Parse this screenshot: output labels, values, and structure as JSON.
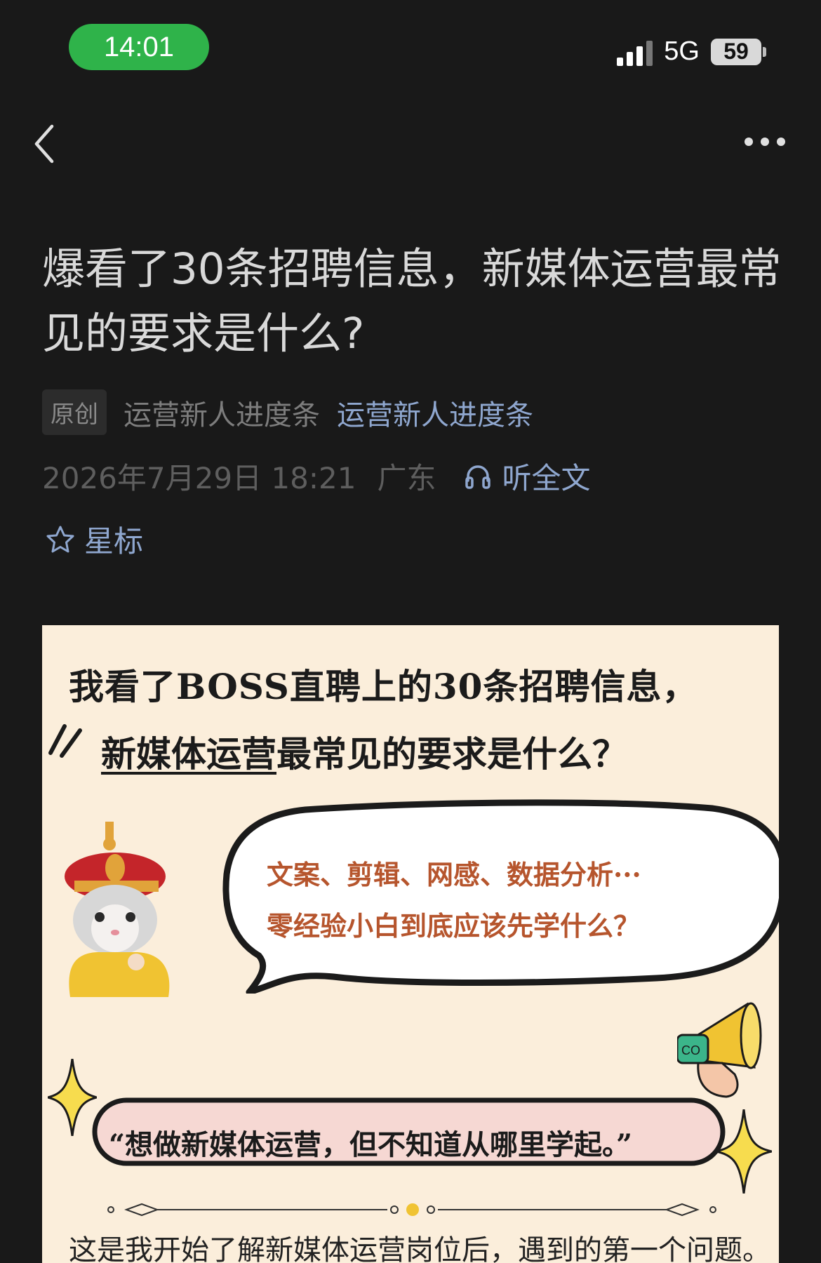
{
  "status_bar": {
    "time": "14:01",
    "network": "5G",
    "battery": "59",
    "colors": {
      "time_pill": "#2fb34a"
    }
  },
  "nav": {
    "back_icon": "chevron-left-icon",
    "more_icon": "more-horizontal-icon"
  },
  "article": {
    "title": "爆看了30条招聘信息，新媒体运营最常见的要求是什么?",
    "badge": "原创",
    "author": "运营新人进度条",
    "account": "运营新人进度条",
    "datetime": "2026年7月29日 18:21",
    "location": "广东",
    "listen_label": "听全文",
    "star_label": "星标",
    "colors": {
      "link": "#8fa7cf",
      "title": "#d9d9d9"
    }
  },
  "cover": {
    "headline_1": "我看了BOSS直聘上的30条招聘信息，",
    "headline_2_underlined": "新媒体运营",
    "headline_2_rest": "最常见的要求是什么？",
    "bubble_line_1": "文案、剪辑、网感、数据分析···",
    "bubble_line_2": "零经验小白到底应该先学什么？",
    "quote": "“想做新媒体运营，但不知道从哪里学起。”",
    "bottom_text": "这是我开始了解新媒体运营岗位后，遇到的第一个问题。",
    "megaphone_label": "CO",
    "colors": {
      "background": "#fbeedb",
      "bubble_text": "#b6552d",
      "quote_bg": "#f6d8d3"
    }
  }
}
